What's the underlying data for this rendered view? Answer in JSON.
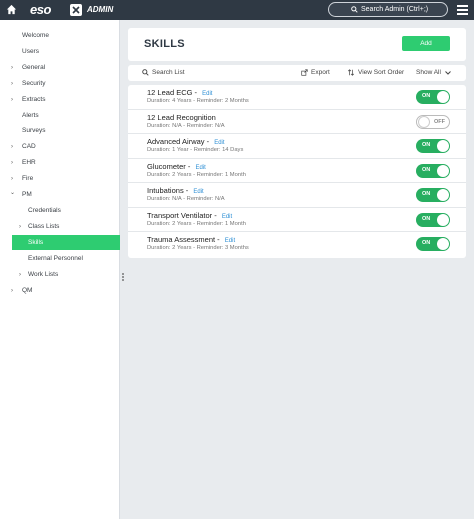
{
  "topbar": {
    "logo": "eso",
    "admin_label": "ADMIN",
    "search_label": "Search Admin (Ctrl+;)"
  },
  "sidebar": {
    "items": [
      {
        "label": "Welcome",
        "chevron": ""
      },
      {
        "label": "Users",
        "chevron": ""
      },
      {
        "label": "General",
        "chevron": "›"
      },
      {
        "label": "Security",
        "chevron": "›"
      },
      {
        "label": "Extracts",
        "chevron": "›"
      },
      {
        "label": "Alerts",
        "chevron": ""
      },
      {
        "label": "Surveys",
        "chevron": ""
      },
      {
        "label": "CAD",
        "chevron": "›"
      },
      {
        "label": "EHR",
        "chevron": "›"
      },
      {
        "label": "Fire",
        "chevron": "›"
      },
      {
        "label": "PM",
        "chevron": "⌄"
      },
      {
        "label": "Credentials",
        "chevron": ""
      },
      {
        "label": "Class Lists",
        "chevron": "›"
      },
      {
        "label": "Skills",
        "chevron": ""
      },
      {
        "label": "External Personnel",
        "chevron": ""
      },
      {
        "label": "Work Lists",
        "chevron": "›"
      },
      {
        "label": "QM",
        "chevron": "›"
      }
    ]
  },
  "header": {
    "title": "SKILLS",
    "add_label": "Add"
  },
  "toolbar": {
    "search_label": "Search List",
    "export_label": "Export",
    "sort_label": "View Sort Order",
    "show_label": "Show All"
  },
  "skills": [
    {
      "name": "12 Lead ECG",
      "editable": true,
      "edit_label": "Edit",
      "details": "Duration: 4 Years - Reminder: 2 Months",
      "toggle": "ON"
    },
    {
      "name": "12 Lead Recognition",
      "editable": false,
      "edit_label": "",
      "details": "Duration: N/A - Reminder: N/A",
      "toggle": "OFF"
    },
    {
      "name": "Advanced Airway",
      "editable": true,
      "edit_label": "Edit",
      "details": "Duration: 1 Year - Reminder: 14 Days",
      "toggle": "ON"
    },
    {
      "name": "Glucometer",
      "editable": true,
      "edit_label": "Edit",
      "details": "Duration: 2 Years - Reminder: 1 Month",
      "toggle": "ON"
    },
    {
      "name": "Intubations",
      "editable": true,
      "edit_label": "Edit",
      "details": "Duration: N/A - Reminder: N/A",
      "toggle": "ON"
    },
    {
      "name": "Transport Ventilator",
      "editable": true,
      "edit_label": "Edit",
      "details": "Duration: 2 Years - Reminder: 1 Month",
      "toggle": "ON"
    },
    {
      "name": "Trauma Assessment",
      "editable": true,
      "edit_label": "Edit",
      "details": "Duration: 2 Years - Reminder: 3 Months",
      "toggle": "ON"
    }
  ],
  "colors": {
    "topbar": "#2f3944",
    "accent_green": "#2ecc71",
    "toggle_on": "#27ae60",
    "link_blue": "#2d8fd5"
  }
}
